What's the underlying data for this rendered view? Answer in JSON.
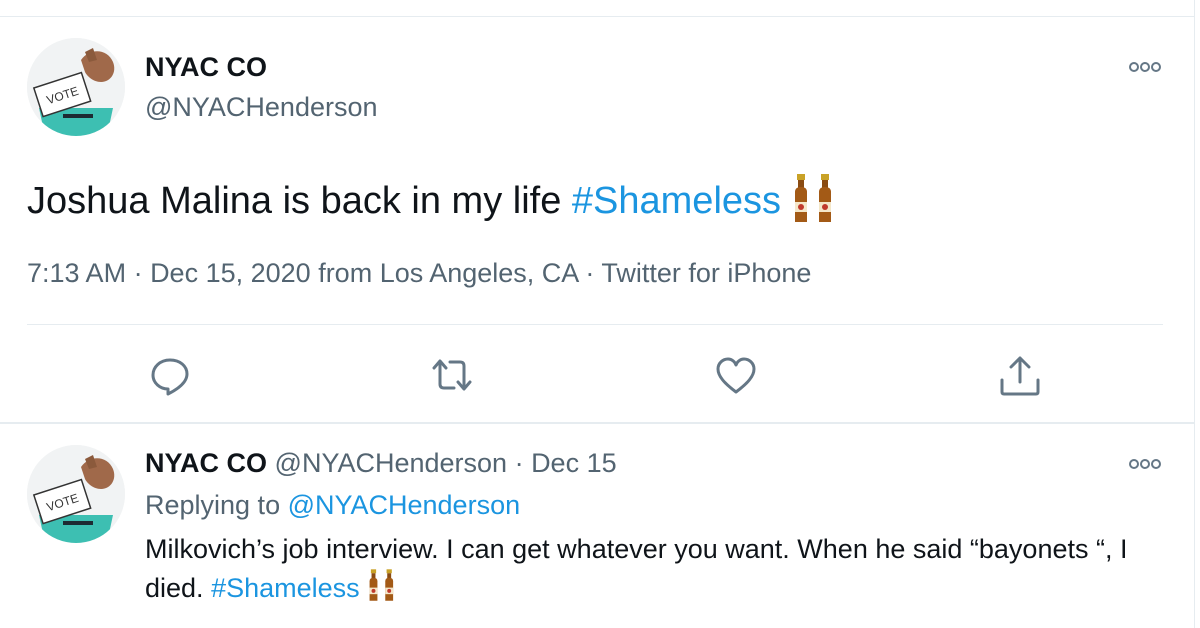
{
  "main_tweet": {
    "display_name": "NYAC CO",
    "handle": "@NYACHenderson",
    "avatar_text": "VOTE",
    "text": "Joshua Malina is back in my life ",
    "hashtag": "#Shameless",
    "emoji": "beers-emoji",
    "time": "7:13 AM",
    "sep1": " · ",
    "date": "Dec 15, 2020",
    "location": " from Los Angeles, CA",
    "sep2": " · ",
    "source": "Twitter for iPhone"
  },
  "actions": {
    "reply_icon": "reply-icon",
    "retweet_icon": "retweet-icon",
    "like_icon": "heart-icon",
    "share_icon": "share-icon"
  },
  "reply_tweet": {
    "display_name": "NYAC CO",
    "handle": "@NYACHenderson",
    "sep": " · ",
    "date": "Dec 15",
    "avatar_text": "VOTE",
    "replying_prefix": "Replying to ",
    "replying_to": "@NYACHenderson",
    "text": "Milkovich’s job interview. I can get whatever you want. When he said “bayonets “, I died. ",
    "hashtag": "#Shameless"
  },
  "colors": {
    "link": "#1b95e0",
    "muted": "#536471",
    "text": "#0f1419",
    "icon": "#657786"
  }
}
